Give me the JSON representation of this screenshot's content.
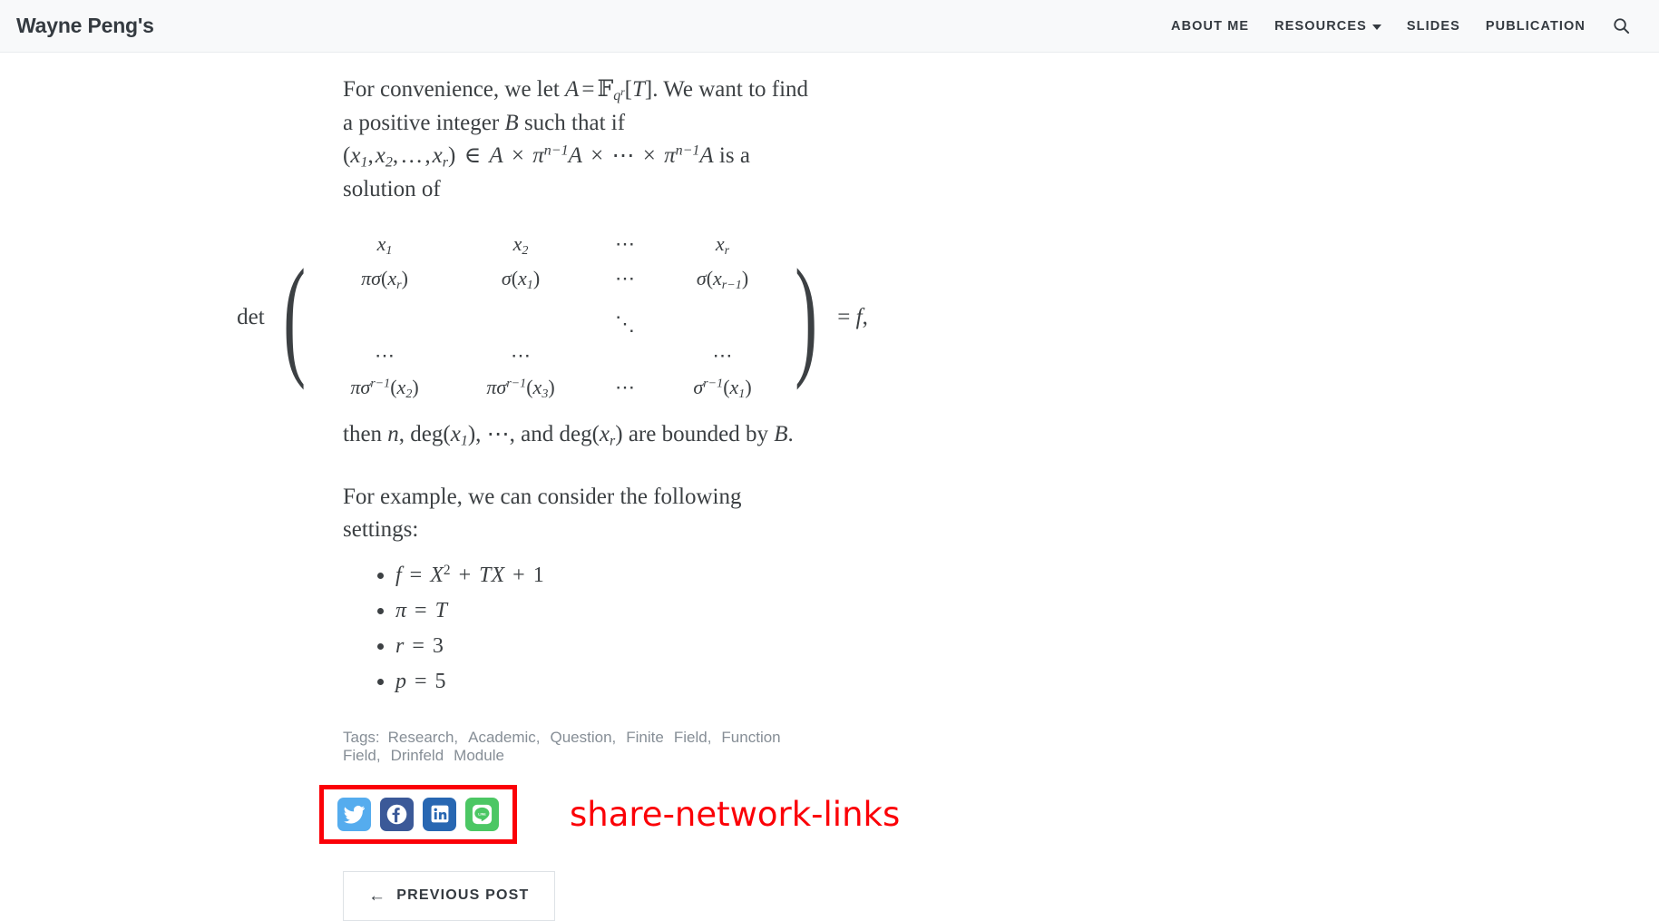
{
  "header": {
    "brand": "Wayne Peng's",
    "nav": [
      {
        "label": "ABOUT ME",
        "icon": null,
        "has_dropdown": false
      },
      {
        "label": "RESOURCES",
        "icon": "chevron-down-icon",
        "has_dropdown": true
      },
      {
        "label": "SLIDES",
        "icon": null,
        "has_dropdown": false
      },
      {
        "label": "PUBLICATION",
        "icon": null,
        "has_dropdown": false
      }
    ],
    "search_icon": "search-icon",
    "background": "#f8f9fa",
    "text_color": "#343a40"
  },
  "article": {
    "paragraph1": {
      "pre": "For convenience, we let ",
      "eq1_A": "A",
      "eq1_rest": " = ℝ_{q^r}[T]",
      "mid": ". We want to find a positive integer ",
      "var_B": "B",
      "post": " such that if ",
      "line2_eq": "(x_1, x_2, …, x_r) ∈ A × π^{n-1} A × ⋯ × π^{n-1} A",
      "line2_tail": " is a solution of"
    },
    "matrix_equation": {
      "det_label": "det",
      "rows": [
        [
          "x₁",
          "x₂",
          "⋯",
          "xᵣ"
        ],
        [
          "πσ(xᵣ)",
          "σ(x₁)",
          "⋯",
          "σ(xᵣ₋₁)"
        ],
        [
          "",
          "",
          "⋱",
          ""
        ],
        [
          "⋯",
          "⋯",
          "",
          "⋯"
        ],
        [
          "πσ^{r-1}(x₂)",
          "πσ^{r-1}(x₃)",
          "⋯",
          "σ^{r-1}(x₁)"
        ]
      ],
      "right_hand_side": "= f,"
    },
    "paragraph2": "then n, deg(x₁), ⋯, and deg(xᵣ) are bounded by B.",
    "paragraph3": "For example, we can consider the following settings:",
    "settings_list": [
      "f = X² + TX + 1",
      "π = T",
      "r = 3",
      "p = 5"
    ]
  },
  "tags": {
    "label": "Tags:",
    "items": [
      "Research,",
      "Academic,",
      "Question,",
      "Finite",
      "Field,",
      "Function",
      "Field,",
      "Drinfeld",
      "Module"
    ]
  },
  "share": {
    "annotation_label": "share-network-links",
    "annotation_color": "#fb0007",
    "networks": [
      {
        "name": "twitter-share-icon",
        "title": "Twitter",
        "color": "#55acee"
      },
      {
        "name": "facebook-share-icon",
        "title": "Facebook",
        "color": "#3b5998"
      },
      {
        "name": "linkedin-share-icon",
        "title": "LinkedIn",
        "color": "#2867b2"
      },
      {
        "name": "line-share-icon",
        "title": "LINE",
        "color": "#4cc764"
      }
    ]
  },
  "pagination": {
    "previous_arrow": "←",
    "previous_label": "PREVIOUS POST"
  }
}
